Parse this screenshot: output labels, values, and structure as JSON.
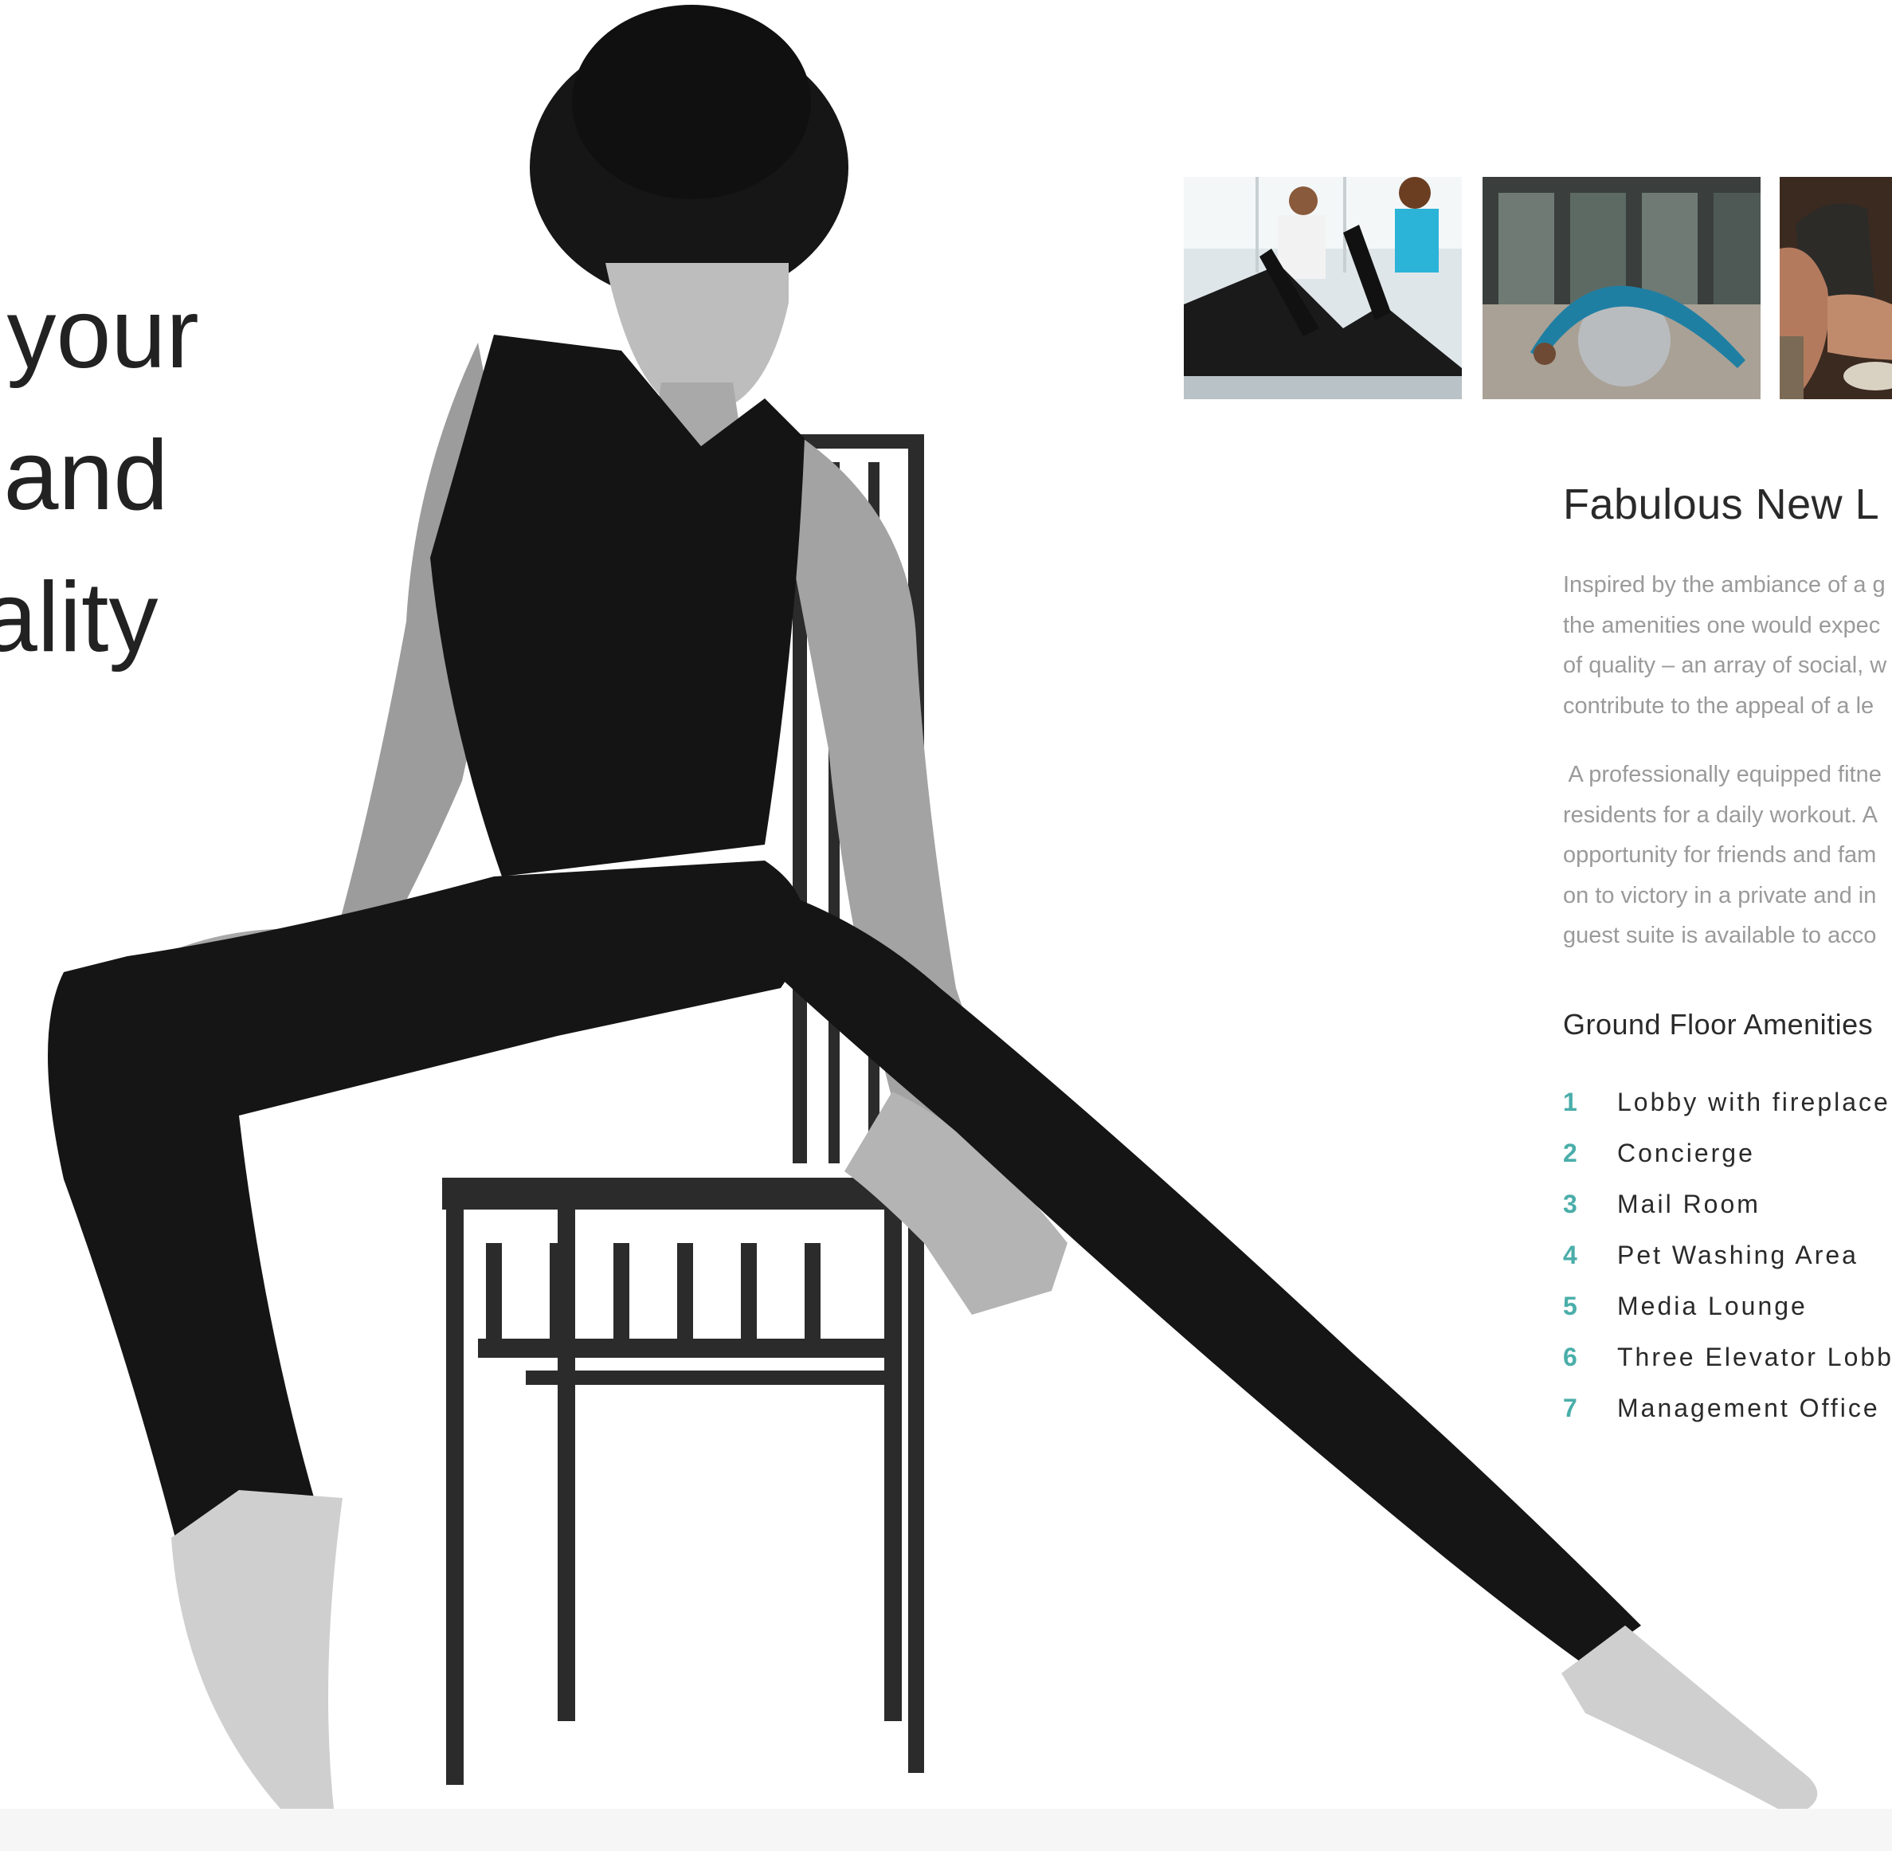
{
  "headline": {
    "line1": "ss your",
    "line2": "y and",
    "line3": "duality"
  },
  "thumbnails": [
    {
      "name": "fitness-photo"
    },
    {
      "name": "yoga-photo"
    },
    {
      "name": "dining-photo"
    }
  ],
  "section": {
    "title": "Fabulous New L",
    "paragraph1": "Inspired by the ambiance of a g\nthe amenities one would expec\nof quality – an array of social, w\ncontribute to the appeal of a le",
    "paragraph2": " A professionally equipped fitne\nresidents for a daily workout. A\nopportunity for friends and fam\non to victory in a private and in\nguest suite is available to acco",
    "subheading": "Ground Floor Amenities"
  },
  "amenities": [
    {
      "num": "1",
      "label": "Lobby with fireplace"
    },
    {
      "num": "2",
      "label": "Concierge"
    },
    {
      "num": "3",
      "label": "Mail Room"
    },
    {
      "num": "4",
      "label": "Pet Washing Area"
    },
    {
      "num": "5",
      "label": "Media Lounge"
    },
    {
      "num": "6",
      "label": "Three Elevator Lobby"
    },
    {
      "num": "7",
      "label": "Management Office"
    }
  ],
  "colors": {
    "accent": "#4aaeaa",
    "heading": "#2a2a2a",
    "body": "#9a9a9a",
    "figure": "#1c1c1c"
  }
}
